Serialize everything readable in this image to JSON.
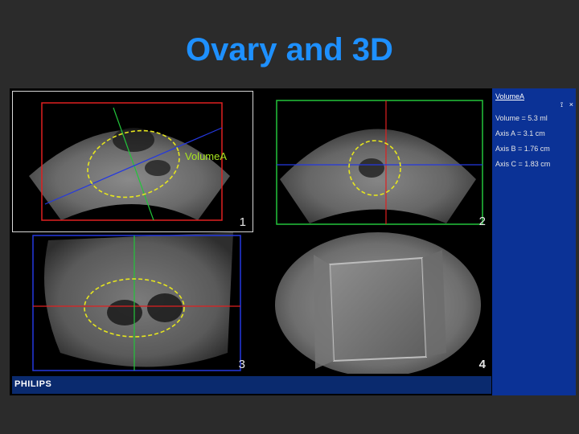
{
  "slide": {
    "title": "Ovary and 3D"
  },
  "panes": [
    {
      "number": "1",
      "label": "VolumeA"
    },
    {
      "number": "2"
    },
    {
      "number": "3"
    },
    {
      "number": "4"
    }
  ],
  "brand": {
    "logo_text": "PHILIPS"
  },
  "panel": {
    "header": "VolumeA",
    "icon_left": "⟟",
    "icon_close": "×",
    "measurements": [
      "Volume = 5.3 ml",
      "Axis A = 3.1 cm",
      "Axis B = 1.76 cm",
      "Axis C = 1.83 cm"
    ]
  },
  "colors": {
    "title": "#1e90ff",
    "volume_outline": "#e6e61e",
    "plane_red": "#e02020",
    "plane_green": "#22c43a",
    "plane_blue": "#2438e0",
    "panel_bg": "#0b3296"
  }
}
